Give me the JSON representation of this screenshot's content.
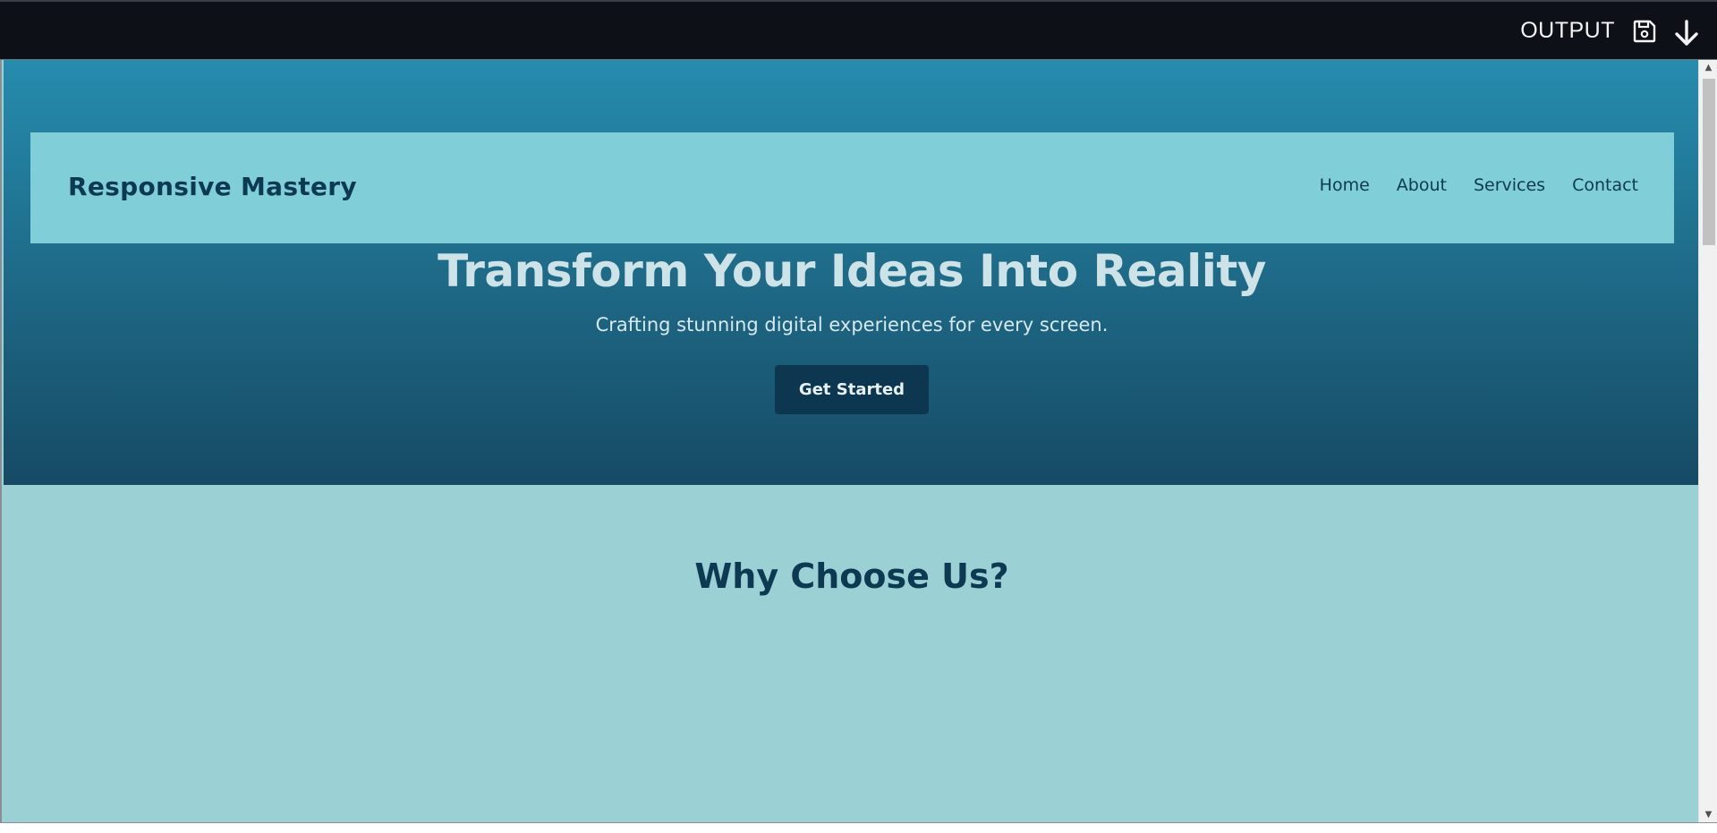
{
  "toolbar": {
    "output_label": "OUTPUT",
    "save_icon": "floppy-disk-icon",
    "download_icon": "arrow-down-icon"
  },
  "navbar": {
    "brand": "Responsive Mastery",
    "links": [
      {
        "label": "Home"
      },
      {
        "label": "About"
      },
      {
        "label": "Services"
      },
      {
        "label": "Contact"
      }
    ]
  },
  "hero": {
    "title": "Transform Your Ideas Into Reality",
    "subtitle": "Crafting stunning digital experiences for every screen.",
    "cta_label": "Get Started"
  },
  "why": {
    "title": "Why Choose Us?"
  },
  "scrollbar": {
    "up_arrow": "▲",
    "down_arrow": "▼"
  },
  "colors": {
    "toolbar_bg": "#0d1117",
    "hero_top": "#268cae",
    "hero_bottom": "#164a64",
    "navbar_bg": "#7fced8",
    "text_dark": "#0d3a52",
    "cta_bg": "#0d3650",
    "section_bg": "#9bd1d5"
  }
}
